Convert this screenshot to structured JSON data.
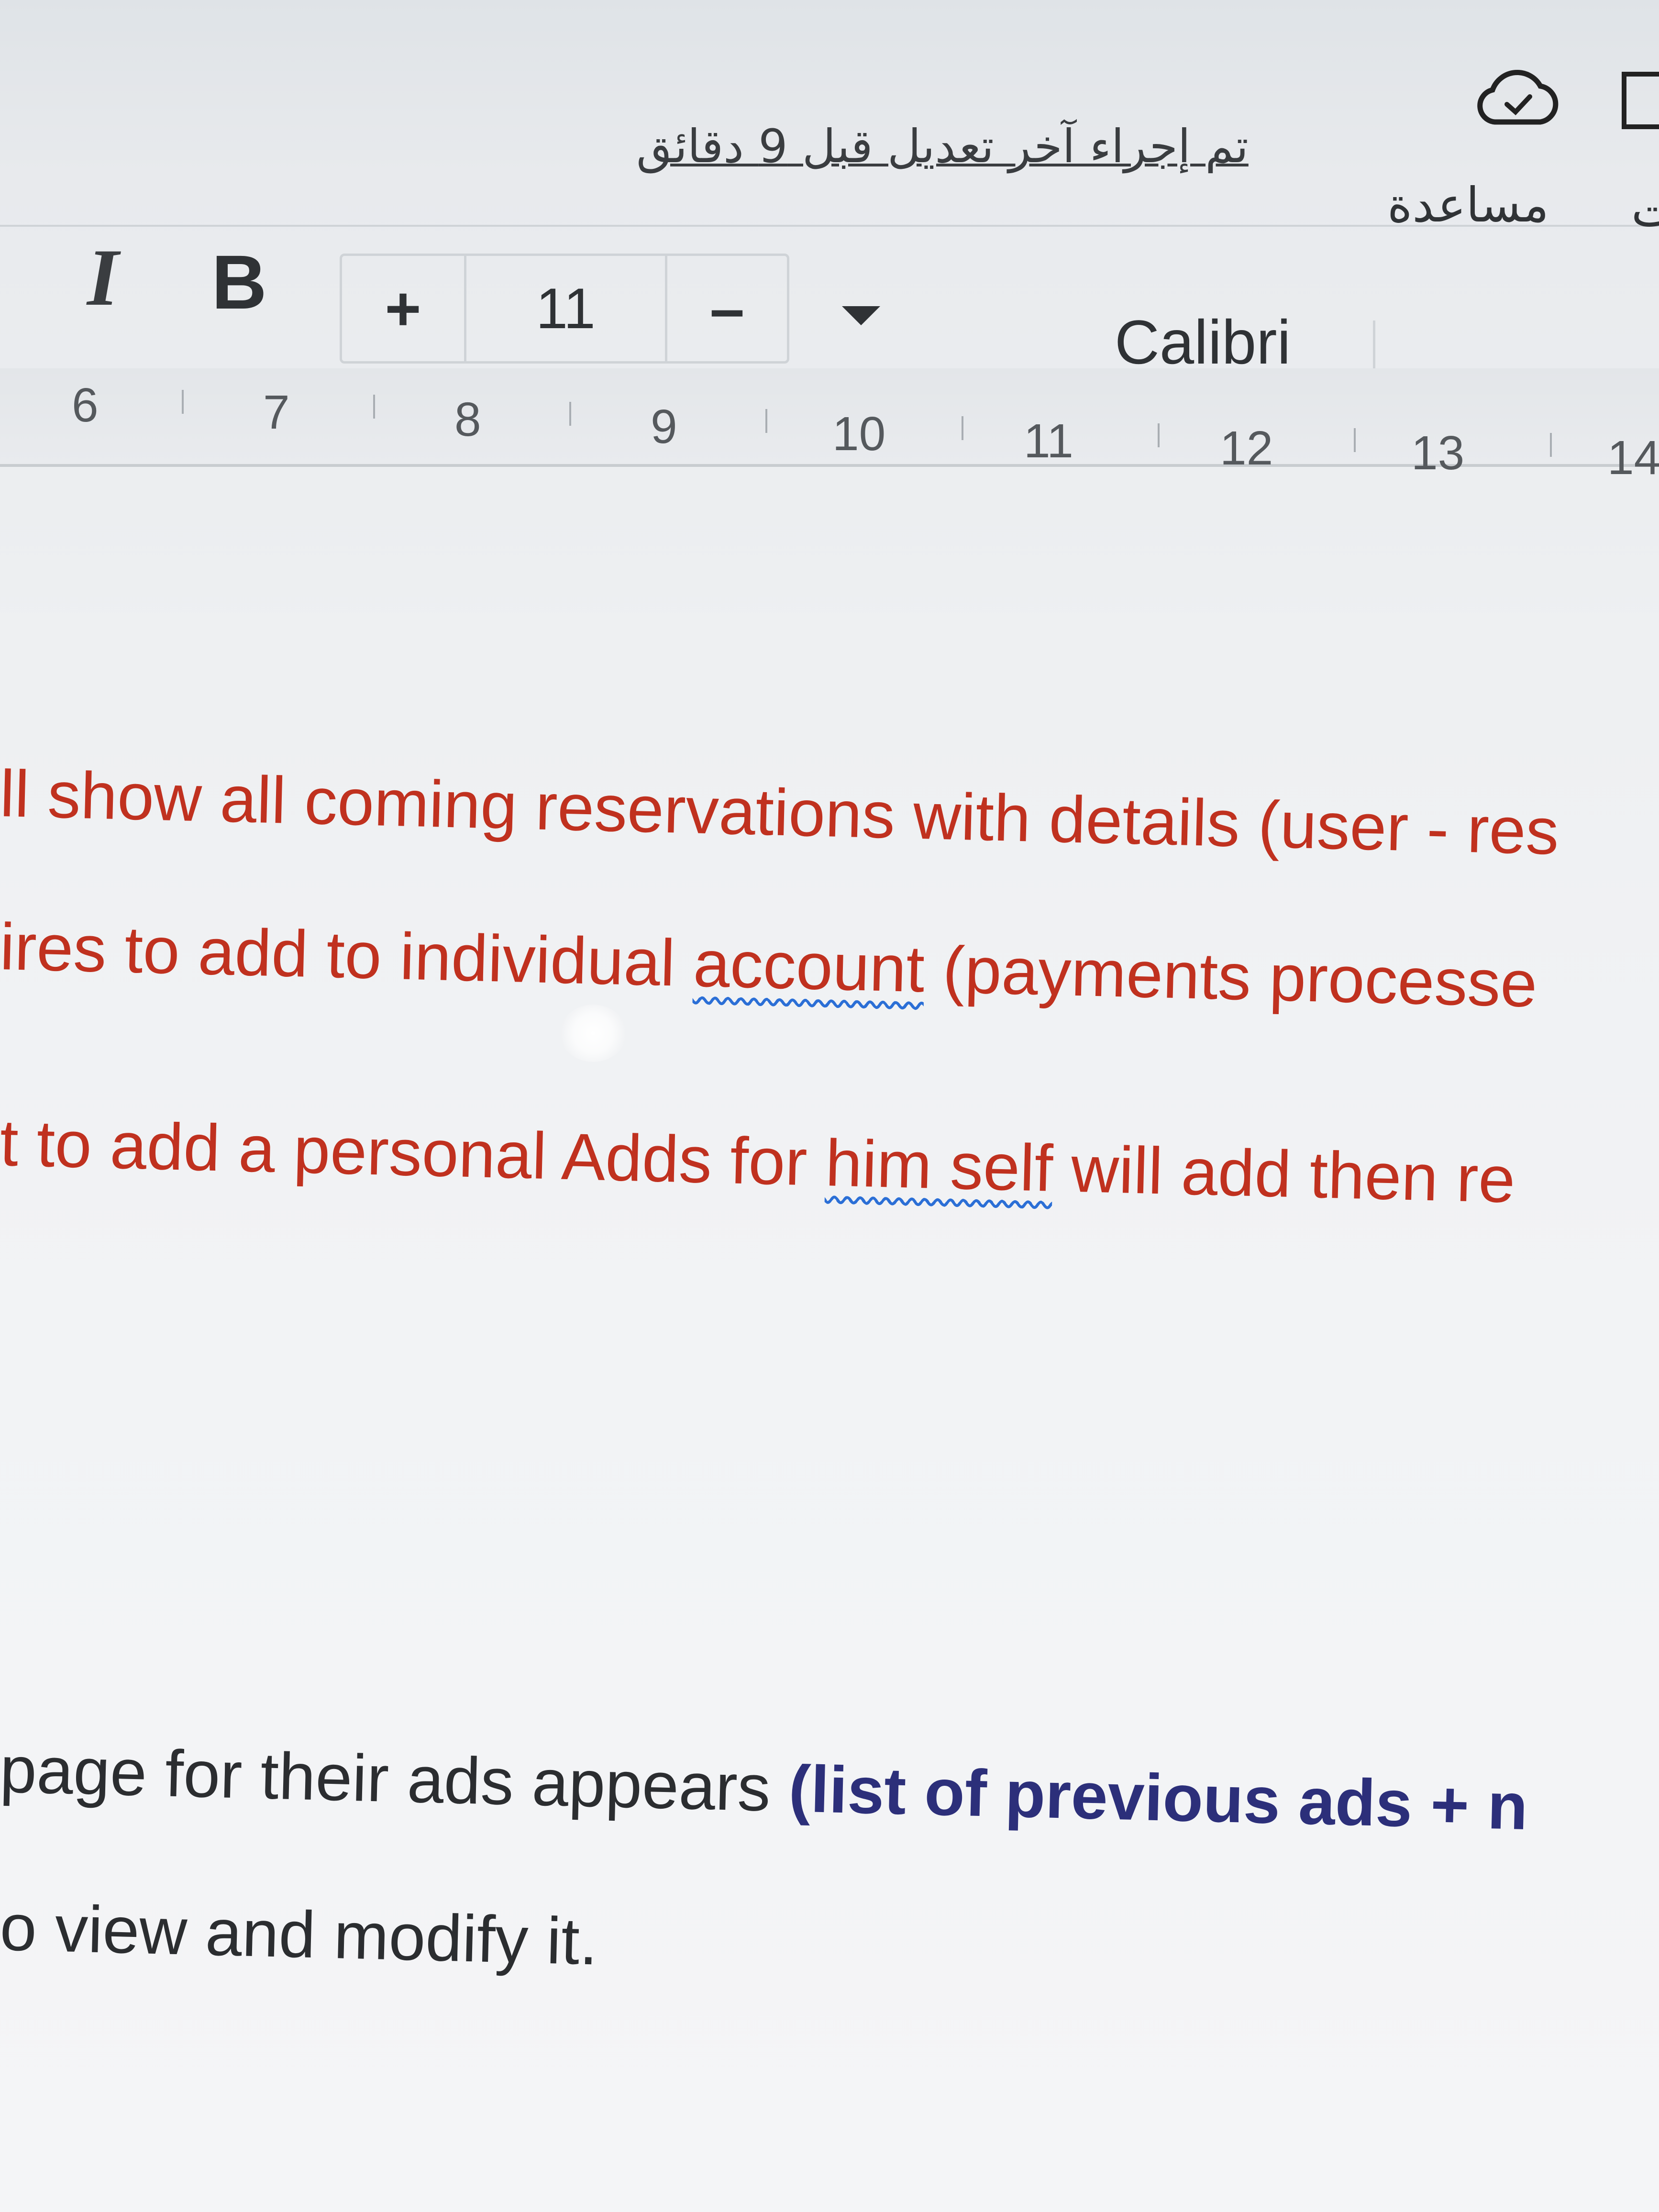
{
  "status_bar": {
    "last_edit": "تم إجراء آخر تعديل قبل 9 دقائق",
    "help_menu": "مساعدة",
    "menu_fragment": "ت",
    "cloud_icon": "cloud-saved-icon"
  },
  "toolbar": {
    "italic_label": "I",
    "bold_label": "B",
    "size_plus_label": "+",
    "font_size": "11",
    "size_minus_label": "–",
    "font_name": "Calibri"
  },
  "ruler": {
    "numbers": [
      "6",
      "7",
      "8",
      "9",
      "10",
      "11",
      "12",
      "13",
      "14"
    ]
  },
  "document": {
    "line1": "ll show all coming reservations with details (user - res",
    "line2_a": "ires to add to individual ",
    "line2_b": "account",
    "line2_c": " (payments processe",
    "line3_a": "t to add a personal Adds for ",
    "line3_b": "him self",
    "line3_c": " will add then re",
    "line4_a": " page for their ads appears ",
    "line4_b": "(list of previous ads + n",
    "line5": "o view and modify it."
  },
  "colors": {
    "requirement_text": "#c0311f",
    "body_text": "#2b2d30",
    "highlight_text": "#2c2f7a",
    "spellcheck_squiggle": "#2b6fd6"
  }
}
